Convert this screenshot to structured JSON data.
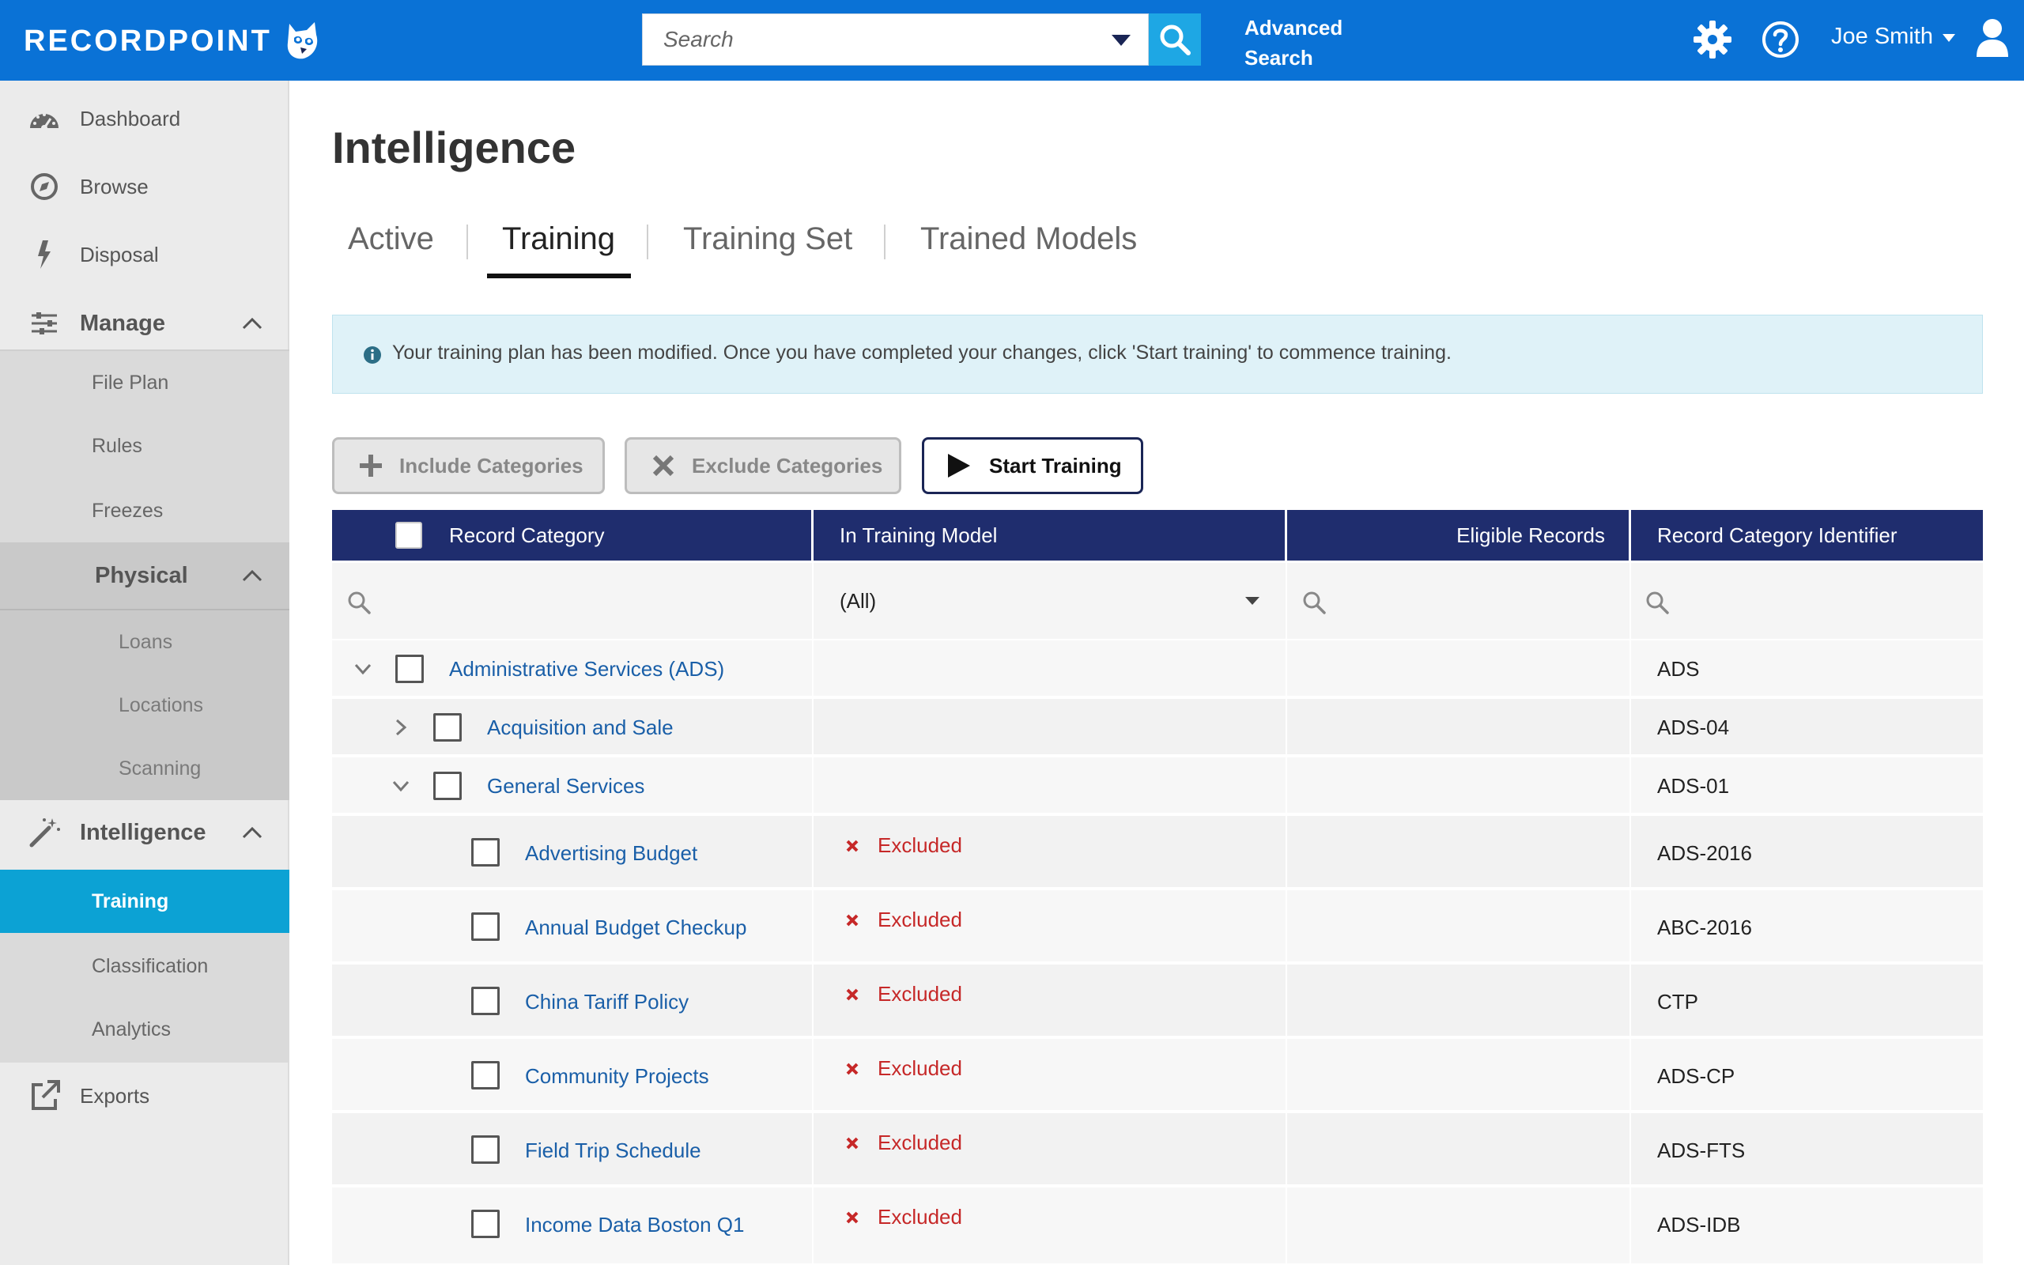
{
  "header": {
    "brand": "RECORDPOINT",
    "search_placeholder": "Search",
    "advanced_search_line1": "Advanced",
    "advanced_search_line2": "Search",
    "user_name": "Joe Smith",
    "colors": {
      "topbar": "#0a72d6",
      "search_button": "#1ea7e4"
    }
  },
  "sidebar": {
    "items": [
      {
        "label": "Dashboard",
        "icon": "dashboard-gauge-icon"
      },
      {
        "label": "Browse",
        "icon": "compass-icon"
      },
      {
        "label": "Disposal",
        "icon": "lightning-icon"
      },
      {
        "label": "Manage",
        "icon": "sliders-icon"
      }
    ],
    "manage_children": [
      "File Plan",
      "Rules",
      "Freezes"
    ],
    "physical_label": "Physical",
    "physical_children": [
      "Loans",
      "Locations",
      "Scanning"
    ],
    "intelligence_label": "Intelligence",
    "intelligence_children": [
      "Training",
      "Classification",
      "Analytics"
    ],
    "exports_label": "Exports",
    "active_item": "Training",
    "active_color": "#0ca2d4"
  },
  "main": {
    "title": "Intelligence",
    "tabs": [
      "Active",
      "Training",
      "Training Set",
      "Trained Models"
    ],
    "active_tab": "Training",
    "info_message": "Your training plan has been modified. Once you have completed your changes, click 'Start training' to commence training.",
    "buttons": {
      "include": "Include Categories",
      "exclude": "Exclude Categories",
      "start": "Start Training"
    }
  },
  "grid": {
    "columns": [
      "Record Category",
      "In Training Model",
      "Eligible Records",
      "Record Category Identifier"
    ],
    "filter_select_value": "(All)",
    "rows": [
      {
        "name": "Administrative Services (ADS)",
        "status": "",
        "eligible": "",
        "identifier": "ADS",
        "level": 0,
        "expander": "expanded"
      },
      {
        "name": "Acquisition and Sale",
        "status": "",
        "eligible": "",
        "identifier": "ADS-04",
        "level": 1,
        "expander": "collapsed"
      },
      {
        "name": "General Services",
        "status": "",
        "eligible": "",
        "identifier": "ADS-01",
        "level": 1,
        "expander": "expanded"
      },
      {
        "name": "Advertising Budget",
        "status": "Excluded",
        "eligible": "",
        "identifier": "ADS-2016",
        "level": 2,
        "expander": "none"
      },
      {
        "name": "Annual Budget Checkup",
        "status": "Excluded",
        "eligible": "",
        "identifier": "ABC-2016",
        "level": 2,
        "expander": "none"
      },
      {
        "name": "China Tariff Policy",
        "status": "Excluded",
        "eligible": "",
        "identifier": "CTP",
        "level": 2,
        "expander": "none"
      },
      {
        "name": "Community Projects",
        "status": "Excluded",
        "eligible": "",
        "identifier": "ADS-CP",
        "level": 2,
        "expander": "none"
      },
      {
        "name": "Field Trip Schedule",
        "status": "Excluded",
        "eligible": "",
        "identifier": "ADS-FTS",
        "level": 2,
        "expander": "none"
      },
      {
        "name": "Income Data Boston Q1",
        "status": "Excluded",
        "eligible": "",
        "identifier": "ADS-IDB",
        "level": 2,
        "expander": "none"
      }
    ],
    "colors": {
      "header": "#1f2d6e",
      "link": "#1a5fa8",
      "excluded": "#c62828"
    }
  }
}
